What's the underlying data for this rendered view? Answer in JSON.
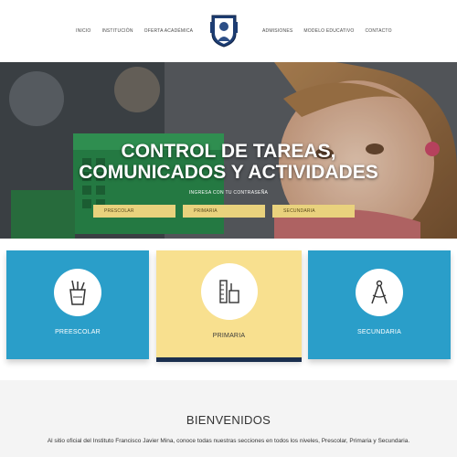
{
  "header": {
    "nav_left": [
      "INICIO",
      "INSTITUCIÓN",
      "OFERTA ACADÉMICA"
    ],
    "nav_right": [
      "ADMISIONES",
      "MODELO EDUCATIVO",
      "CONTACTO"
    ],
    "logo_icon": "school-crest-icon"
  },
  "hero": {
    "title_line1": "CONTROL DE TAREAS,",
    "title_line2": "COMUNICADOS Y ACTIVIDADES",
    "subtitle": "INGRESA CON TU CONTRASEÑA",
    "buttons": [
      "PRESCOLAR",
      "PRIMARIA",
      "SECUNDARIA"
    ]
  },
  "levels": [
    {
      "label": "PREESCOLAR",
      "icon": "pencil-cup-icon"
    },
    {
      "label": "PRIMARIA",
      "icon": "ruler-icon"
    },
    {
      "label": "SECUNDARIA",
      "icon": "compass-icon"
    }
  ],
  "welcome": {
    "title": "BIENVENIDOS",
    "text": "Al sitio oficial del Instituto Francisco Javier Mina, conoce todas nuestras secciones en todos los niveles, Prescolar, Primaria y Secundaria."
  },
  "colors": {
    "blue": "#2a9ec9",
    "yellow": "#f8e08f",
    "navy": "#1b2f4f",
    "hero_button": "#e9d27d"
  }
}
